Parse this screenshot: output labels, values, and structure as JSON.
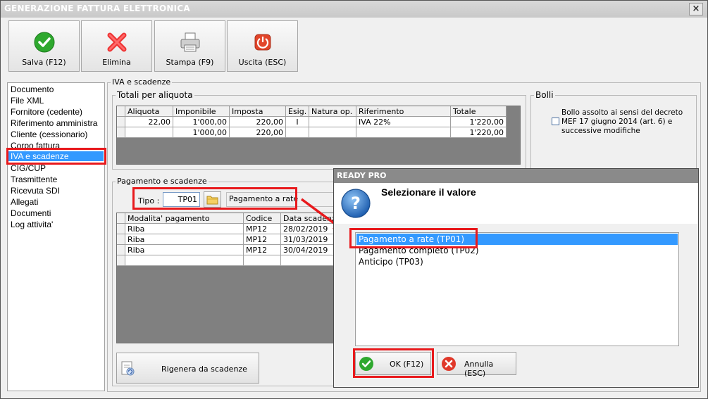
{
  "window": {
    "title": "GENERAZIONE FATTURA ELETTRONICA",
    "close": "×"
  },
  "toolbar": {
    "save": "Salva (F12)",
    "delete": "Elimina",
    "print": "Stampa (F9)",
    "exit": "Uscita (ESC)"
  },
  "nav": {
    "items": [
      "Documento",
      "File XML",
      "Fornitore (cedente)",
      "Riferimento amministra",
      "Cliente (cessionario)",
      "Corpo fattura",
      "IVA e scadenze",
      "CIG/CUP",
      "Trasmittente",
      "Ricevuta SDI",
      "Allegati",
      "Documenti",
      "Log attivita'"
    ],
    "selected": "IVA e scadenze"
  },
  "section": {
    "title": "IVA e scadenze"
  },
  "totals": {
    "label": "Totali per aliquota",
    "headers": [
      "Aliquota",
      "Imponibile",
      "Imposta",
      "Esig.",
      "Natura op.",
      "Riferimento",
      "Totale"
    ],
    "rows": [
      [
        "22,00",
        "1'000,00",
        "220,00",
        "I",
        "",
        "IVA 22%",
        "1'220,00"
      ],
      [
        "",
        "1'000,00",
        "220,00",
        "",
        "",
        "",
        "1'220,00"
      ]
    ]
  },
  "bolli": {
    "label": "Bolli",
    "text": "Bollo assolto ai sensi del decreto MEF 17 giugno 2014 (art. 6) e successive modifiche",
    "checked": false
  },
  "pagamento": {
    "label": "Pagamento e scadenze",
    "tipo_label": "Tipo :",
    "tipo_value": "TP01",
    "tipo_desc": "Pagamento a rate",
    "headers": [
      "Modalita' pagamento",
      "Codice",
      "Data scadenza"
    ],
    "rows": [
      [
        "Riba",
        "MP12",
        "28/02/2019"
      ],
      [
        "Riba",
        "MP12",
        "31/03/2019"
      ],
      [
        "Riba",
        "MP12",
        "30/04/2019"
      ]
    ],
    "regen_button": "Rigenera da scadenze"
  },
  "dialog": {
    "title": "READY PRO",
    "header": "Selezionare il valore",
    "options": [
      "Pagamento a rate (TP01)",
      "Pagamento completo (TP02)",
      "Anticipo (TP03)"
    ],
    "selected": "Pagamento a rate (TP01)",
    "ok": "OK (F12)",
    "cancel": "Annulla (ESC)"
  },
  "colors": {
    "highlight": "#e8191c",
    "selection": "#3399ff"
  }
}
